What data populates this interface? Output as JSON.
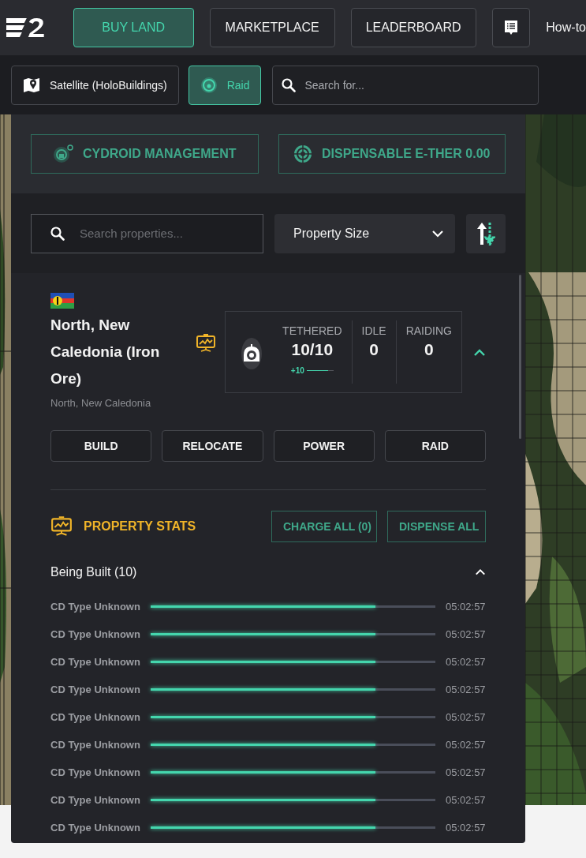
{
  "nav": {
    "tabs": [
      {
        "label": "BUY LAND",
        "selected": true
      },
      {
        "label": "MARKETPLACE",
        "selected": false
      },
      {
        "label": "LEADERBOARD",
        "selected": false
      }
    ],
    "howto": "How-to"
  },
  "toolbar": {
    "layer": "Satellite (HoloBuildings)",
    "raid": {
      "label": "Raid",
      "selected": true
    },
    "search": {
      "placeholder": "Search for..."
    }
  },
  "panel": {
    "actions": [
      "CYDROID MANAGEMENT",
      "DISPENSABLE E-THER 0.00"
    ],
    "filters": {
      "search": {
        "placeholder": "Search properties..."
      },
      "sort": "Property Size"
    },
    "property": {
      "title": "North, New Caledonia (Iron Ore)",
      "subtitle": "North, New Caledonia",
      "expanded": true,
      "stats": [
        {
          "label": "TETHERED",
          "value": "10/10",
          "delta": "+10",
          "level": 0.8
        },
        {
          "label": "IDLE",
          "value": "0"
        },
        {
          "label": "RAIDING",
          "value": "0"
        }
      ],
      "buttons": [
        "BUILD",
        "RELOCATE",
        "POWER",
        "RAID"
      ],
      "stats_section": {
        "title": "PROPERTY STATS",
        "buttons": [
          "CHARGE ALL (0)",
          "DISPENSE ALL"
        ]
      },
      "group": {
        "title": "Being Built (10)",
        "expanded": true,
        "items": [
          {
            "name": "CD Type Unknown",
            "level": 0.79,
            "time": "05:02:57"
          },
          {
            "name": "CD Type Unknown",
            "level": 0.79,
            "time": "05:02:57"
          },
          {
            "name": "CD Type Unknown",
            "level": 0.79,
            "time": "05:02:57"
          },
          {
            "name": "CD Type Unknown",
            "level": 0.79,
            "time": "05:02:57"
          },
          {
            "name": "CD Type Unknown",
            "level": 0.79,
            "time": "05:02:57"
          },
          {
            "name": "CD Type Unknown",
            "level": 0.79,
            "time": "05:02:57"
          },
          {
            "name": "CD Type Unknown",
            "level": 0.79,
            "time": "05:02:57"
          },
          {
            "name": "CD Type Unknown",
            "level": 0.79,
            "time": "05:02:57"
          },
          {
            "name": "CD Type Unknown",
            "level": 0.79,
            "time": "05:02:57"
          }
        ]
      }
    }
  }
}
